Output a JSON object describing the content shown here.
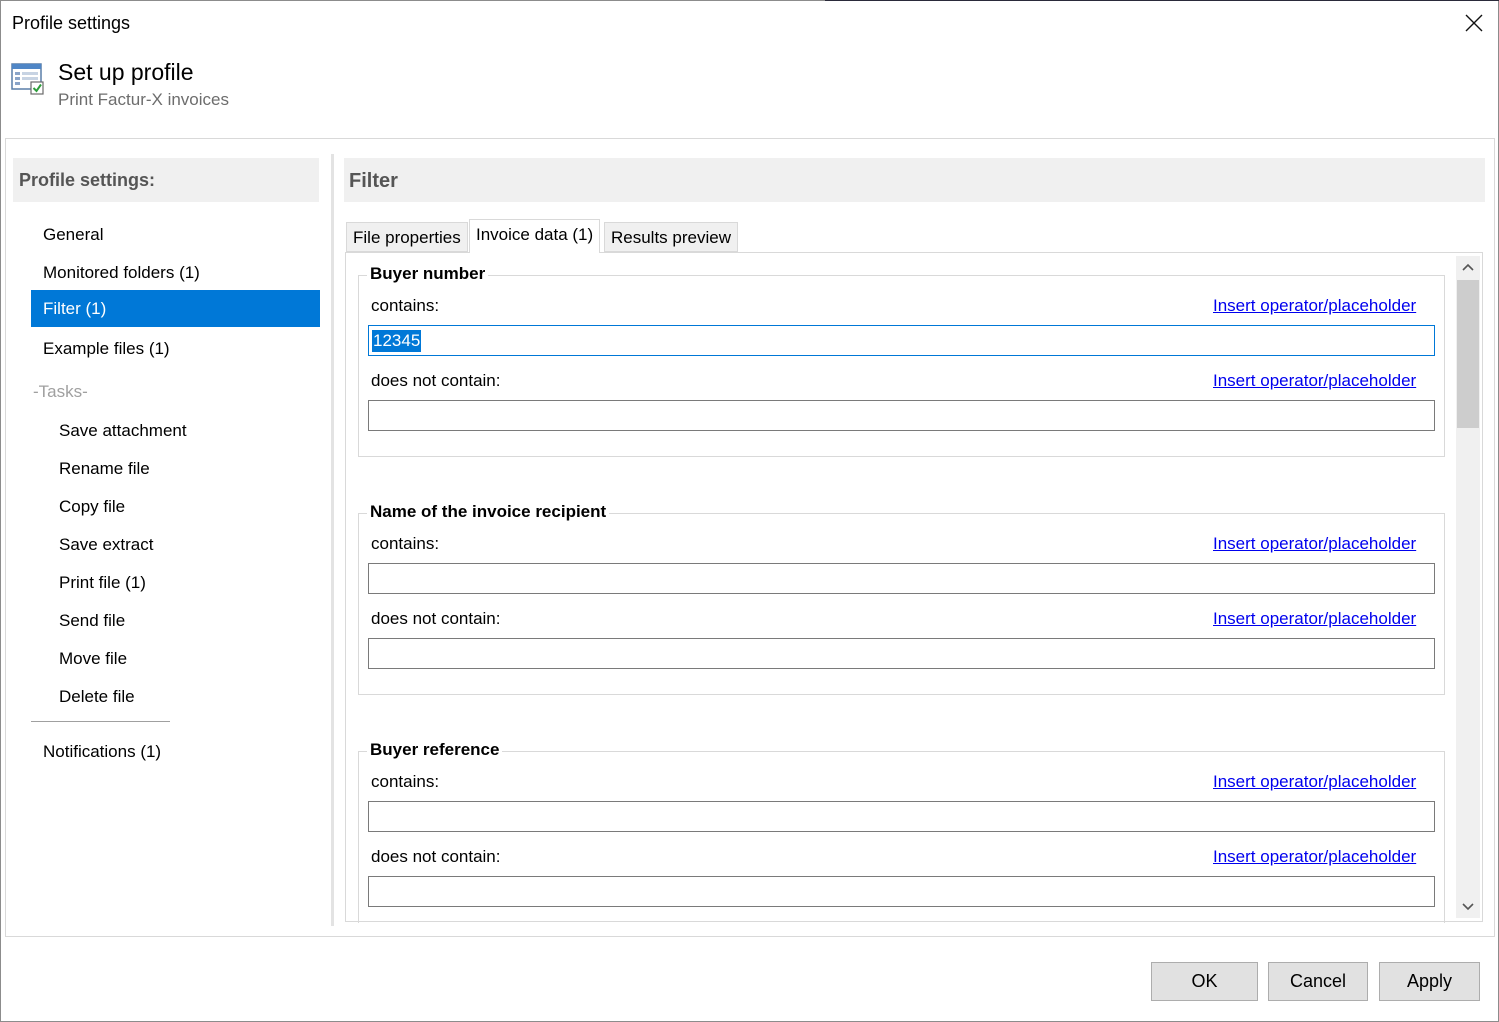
{
  "window": {
    "title": "Profile settings"
  },
  "header": {
    "title": "Set up profile",
    "subtitle": "Print Factur-X invoices",
    "icon": "profile-settings-icon"
  },
  "nav": {
    "header": "Profile settings:",
    "items": [
      {
        "label": "General"
      },
      {
        "label": "Monitored folders (1)"
      },
      {
        "label": "Filter (1)",
        "active": true
      },
      {
        "label": "Example files (1)"
      }
    ],
    "tasks_label": "-Tasks-",
    "tasks": [
      {
        "label": "Save attachment"
      },
      {
        "label": "Rename file"
      },
      {
        "label": "Copy file"
      },
      {
        "label": "Save extract"
      },
      {
        "label": "Print file (1)"
      },
      {
        "label": "Send file"
      },
      {
        "label": "Move file"
      },
      {
        "label": "Delete file"
      }
    ],
    "notifications": "Notifications (1)"
  },
  "main": {
    "title": "Filter",
    "tabs": [
      {
        "label": "File properties"
      },
      {
        "label": "Invoice data (1)",
        "active": true
      },
      {
        "label": "Results preview"
      }
    ],
    "groups": [
      {
        "title": "Buyer number",
        "contains_label": "contains:",
        "contains_value": "12345",
        "not_contains_label": "does not contain:",
        "not_contains_value": "",
        "link": "Insert operator/placeholder"
      },
      {
        "title": "Name of the invoice recipient",
        "contains_label": "contains:",
        "contains_value": "",
        "not_contains_label": "does not contain:",
        "not_contains_value": "",
        "link": "Insert operator/placeholder"
      },
      {
        "title": "Buyer reference",
        "contains_label": "contains:",
        "contains_value": "",
        "not_contains_label": "does not contain:",
        "not_contains_value": "",
        "link": "Insert operator/placeholder"
      }
    ]
  },
  "buttons": {
    "ok": "OK",
    "cancel": "Cancel",
    "apply": "Apply"
  },
  "colors": {
    "accent": "#0078d7",
    "link": "#0000ee",
    "header_bg": "#f0f0f0"
  }
}
